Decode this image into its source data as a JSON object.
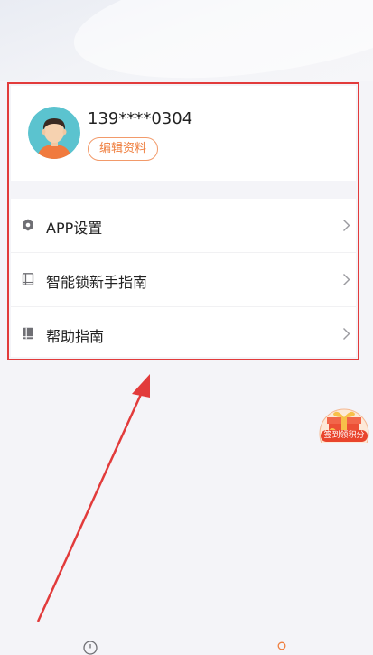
{
  "profile": {
    "phone": "139****0304",
    "edit_label": "编辑资料"
  },
  "menu": {
    "items": [
      {
        "label": "APP设置",
        "icon": "settings-hex-icon"
      },
      {
        "label": "智能锁新手指南",
        "icon": "book-outline-icon"
      },
      {
        "label": "帮助指南",
        "icon": "book-filled-icon"
      }
    ]
  },
  "gift": {
    "label": "签到领积分",
    "icon": "gift-box-icon"
  },
  "colors": {
    "accent": "#ef7d3c",
    "highlight": "#e23b3b",
    "gift_red": "#e9442c"
  }
}
